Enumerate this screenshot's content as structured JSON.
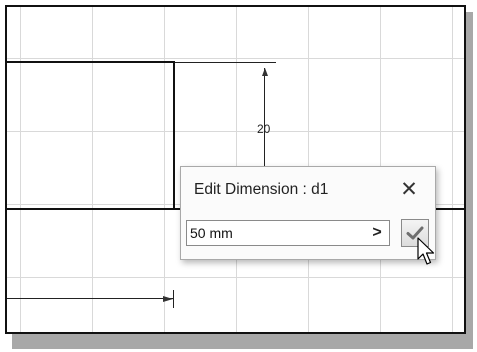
{
  "sketch": {
    "dimension_value": "20"
  },
  "dialog": {
    "title": "Edit Dimension : d1",
    "close_symbol": "✕",
    "input_value": "50 mm",
    "expand_symbol": ">",
    "ok_icon": "checkmark-icon"
  },
  "colors": {
    "ok_check": "#6e6e6e",
    "grid": "#d9d9d9",
    "geometry": "#111111"
  }
}
